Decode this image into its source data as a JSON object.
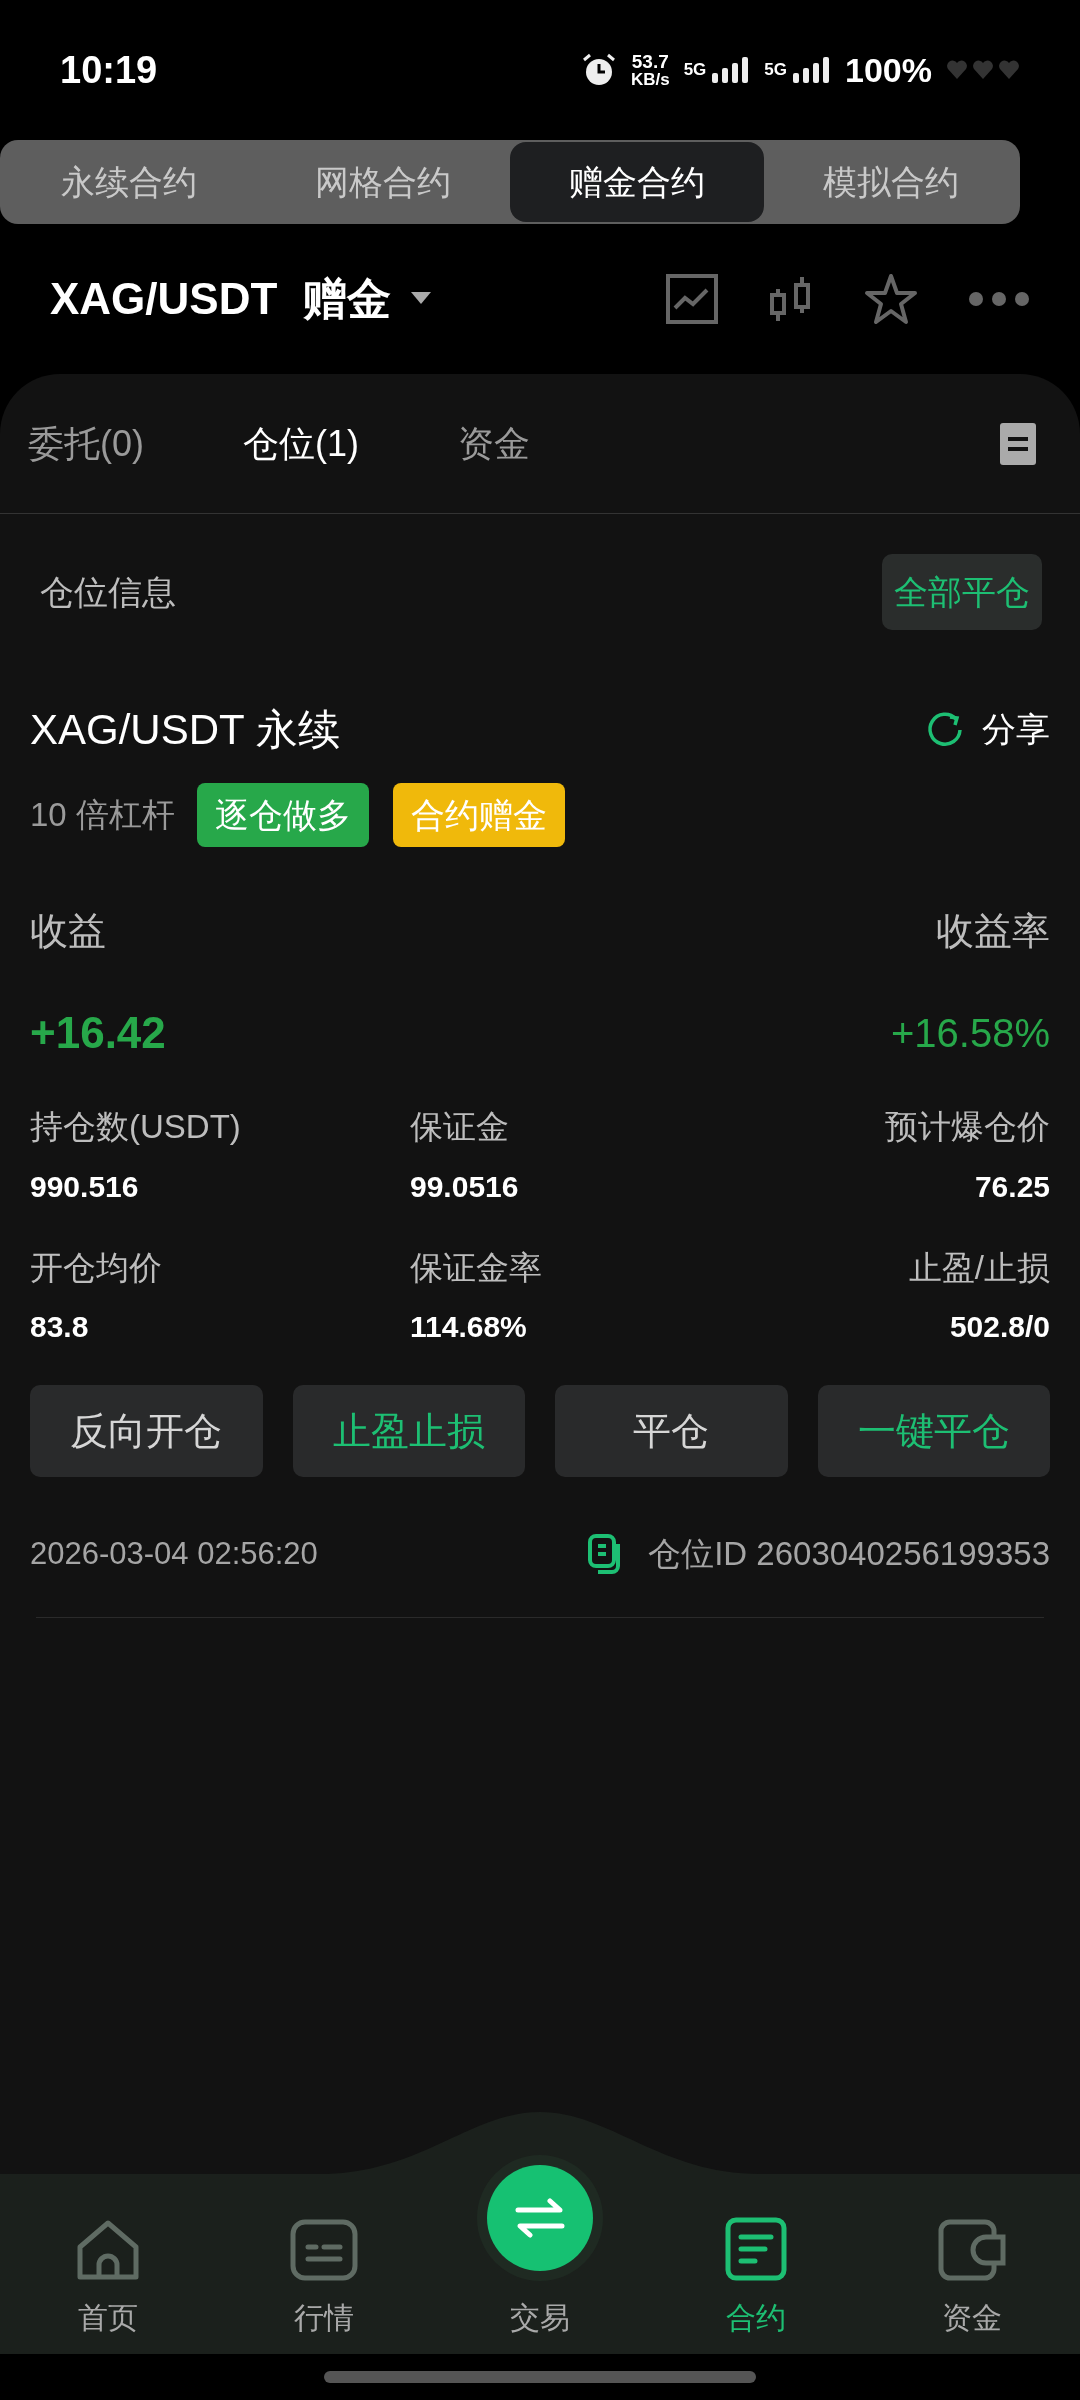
{
  "status_bar": {
    "time": "10:19",
    "speed": "53.7",
    "speed_unit": "KB/s",
    "net_1": "5G",
    "net_2": "5G",
    "battery": "100%"
  },
  "product_tabs": [
    {
      "label": "永续合约",
      "selected": false
    },
    {
      "label": "网格合约",
      "selected": false
    },
    {
      "label": "赠金合约",
      "selected": true
    },
    {
      "label": "模拟合约",
      "selected": false
    }
  ],
  "header": {
    "pair": "XAG/USDT",
    "mode": "赠金"
  },
  "sub_tabs": [
    {
      "label": "委托(0)",
      "selected": false
    },
    {
      "label": "仓位(1)",
      "selected": true
    },
    {
      "label": "资金",
      "selected": false
    }
  ],
  "section": {
    "title": "仓位信息",
    "close_all": "全部平仓"
  },
  "position": {
    "symbol": "XAG/USDT 永续",
    "share": "分享",
    "leverage": "10 倍杠杆",
    "tags": [
      {
        "label": "逐仓做多",
        "color": "#27a84a"
      },
      {
        "label": "合约赠金",
        "color": "#f0b90b"
      }
    ],
    "pnl_label": "收益",
    "roe_label": "收益率",
    "pnl": "+16.42",
    "roe": "+16.58%",
    "stats": [
      {
        "label": "持仓数(USDT)",
        "value": "990.516"
      },
      {
        "label": "保证金",
        "value": "99.0516"
      },
      {
        "label": "预计爆仓价",
        "value": "76.25"
      },
      {
        "label": "开仓均价",
        "value": "83.8"
      },
      {
        "label": "保证金率",
        "value": "114.68%"
      },
      {
        "label": "止盈/止损",
        "value": "502.8/0"
      }
    ],
    "actions": [
      {
        "label": "反向开仓",
        "kind": "plain"
      },
      {
        "label": "止盈止损",
        "kind": "accent"
      },
      {
        "label": "平仓",
        "kind": "plain"
      },
      {
        "label": "一键平仓",
        "kind": "accent"
      }
    ],
    "time": "2026-03-04 02:56:20",
    "position_id": "仓位ID 2603040256199353"
  },
  "bottom_nav": [
    {
      "label": "首页",
      "kind": "home",
      "selected": false
    },
    {
      "label": "行情",
      "kind": "market",
      "selected": false
    },
    {
      "label": "交易",
      "kind": "trade",
      "selected": false
    },
    {
      "label": "合约",
      "kind": "contract",
      "selected": true
    },
    {
      "label": "资金",
      "kind": "wallet",
      "selected": false
    }
  ]
}
